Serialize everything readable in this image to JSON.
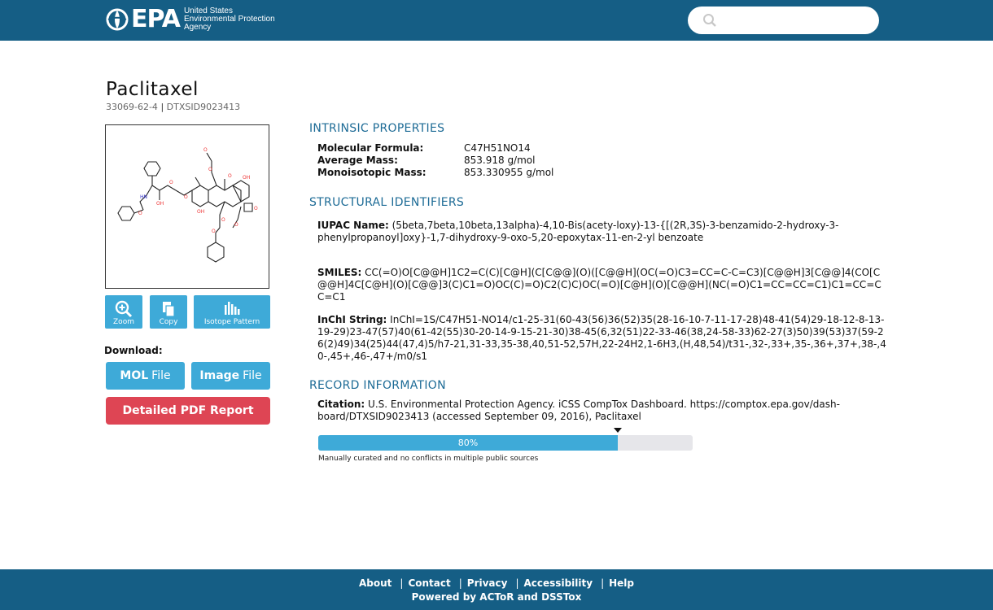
{
  "header": {
    "logo_text": "EPA",
    "agency_lines": [
      "United States",
      "Environmental Protection",
      "Agency"
    ],
    "search_placeholder": "",
    "bg_color": "#155e85"
  },
  "compound": {
    "name": "Paclitaxel",
    "cas": "33069-62-4",
    "separator": "|",
    "dtxsid": "DTXSID9023413"
  },
  "tools": {
    "zoom_label": "Zoom",
    "copy_label": "Copy",
    "isotope_label": "Isotope Pattern"
  },
  "download": {
    "label": "Download:",
    "mol_bold": "MOL",
    "mol_rest": "File",
    "image_bold": "Image",
    "image_rest": "File",
    "pdf_label": "Detailed PDF Report"
  },
  "intrinsic": {
    "heading": "INTRINSIC PROPERTIES",
    "formula_key": "Molecular Formula:",
    "formula_val": "C47H51NO14",
    "avg_mass_key": "Average Mass:",
    "avg_mass_val": "853.918 g/mol",
    "mono_mass_key": "Monoisotopic Mass:",
    "mono_mass_val": "853.330955 g/mol"
  },
  "structural": {
    "heading": "STRUCTURAL IDENTIFIERS",
    "iupac_key": "IUPAC Name:",
    "iupac_val": "(5beta,7beta,10beta,13alpha)-4,10-Bis(acety-loxy)-13-{[(2R,3S)-3-benzamido-2-hydroxy-3-phenylpropanoyl]oxy}-1,7-dihydroxy-9-oxo-5,20-epoxytax-11-en-2-yl benzoate",
    "smiles_key": "SMILES:",
    "smiles_val": "CC(=O)O[C@@H]1C2=C(C)[C@H](C[C@@](O)([C@@H](OC(=O)C3=CC=C-C=C3)[C@@H]3[C@@]4(CO[C@@H]4C[C@H](O)[C@@]3(C)C1=O)OC(C)=O)C2(C)C)OC(=O)[C@H](O)[C@@H](NC(=O)C1=CC=CC=C1)C1=CC=CC=C1",
    "inchi_key": "InChI String:",
    "inchi_val": "InChI=1S/C47H51-NO14/c1-25-31(60-43(56)36(52)35(28-16-10-7-11-17-28)48-41(54)29-18-12-8-13-19-29)23-47(57)40(61-42(55)30-20-14-9-15-21-30)38-45(6,32(51)22-33-46(38,24-58-33)62-27(3)50)39(53)37(59-26(2)49)34(25)44(47,4)5/h7-21,31-33,35-38,40,51-52,57H,22-24H2,1-6H3,(H,48,54)/t31-,32-,33+,35-,36+,37+,38-,40-,45+,46-,47+/m0/s1"
  },
  "record": {
    "heading": "RECORD INFORMATION",
    "citation_key": "Citation:",
    "citation_val": "U.S. Environmental Protection Agency. iCSS CompTox Dashboard. https://comptox.epa.gov/dash-board/DTXSID9023413 (accessed September 09, 2016), Paclitaxel",
    "quality_percent": 80,
    "quality_label": "80%",
    "quality_caption": "Manually curated and no conflicts in multiple public sources",
    "bar_color": "#3eaad8"
  },
  "footer": {
    "links": [
      "About",
      "Contact",
      "Privacy",
      "Accessibility",
      "Help"
    ],
    "powered_prefix": "Powered by",
    "powered_a": "ACToR",
    "powered_and": "and",
    "powered_b": "DSSTox"
  }
}
